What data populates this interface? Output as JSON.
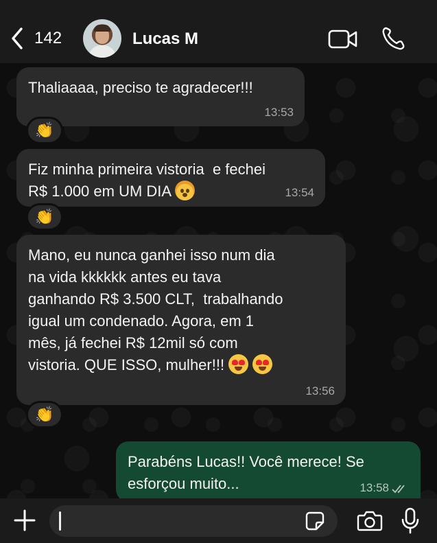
{
  "header": {
    "back_count": "142",
    "contact_name": "Lucas M",
    "icons": [
      "chevron-left-icon",
      "video-call-icon",
      "phone-icon"
    ]
  },
  "messages": [
    {
      "direction": "incoming",
      "text": "Thaliaaaa, preciso te agradecer!!!",
      "time": "13:53",
      "reaction": "👏"
    },
    {
      "direction": "incoming",
      "text_line1": "Fiz minha primeira vistoria  e fechei",
      "text_line2": "R$ 1.000 em UM DIA",
      "emoji": "exploding-head",
      "time": "13:54",
      "reaction": "👏"
    },
    {
      "direction": "incoming",
      "text": "Mano, eu nunca ganhei isso num dia\nna vida kkkkkk antes eu tava\nganhando R$ 3.500 CLT,  trabalhando\nigual um condenado. Agora, em 1\nmês, já fechei R$ 12mil só com\nvistoria. QUE ISSO, mulher!!!",
      "emoji": "heart-eyes",
      "time": "13:56",
      "reaction": "👏"
    },
    {
      "direction": "outgoing",
      "text": "Parabéns Lucas!! Você merece! Se\nesforçou muito...",
      "time": "13:58",
      "status": "read"
    }
  ],
  "composer": {
    "placeholder": "",
    "icons": [
      "plus-icon",
      "sticker-icon",
      "camera-icon",
      "mic-icon"
    ]
  },
  "colors": {
    "header_bg": "#1b1b1b",
    "incoming_bubble": "#2b2b2c",
    "outgoing_bubble": "#154a32",
    "timestamp": "#a8a8a8"
  }
}
